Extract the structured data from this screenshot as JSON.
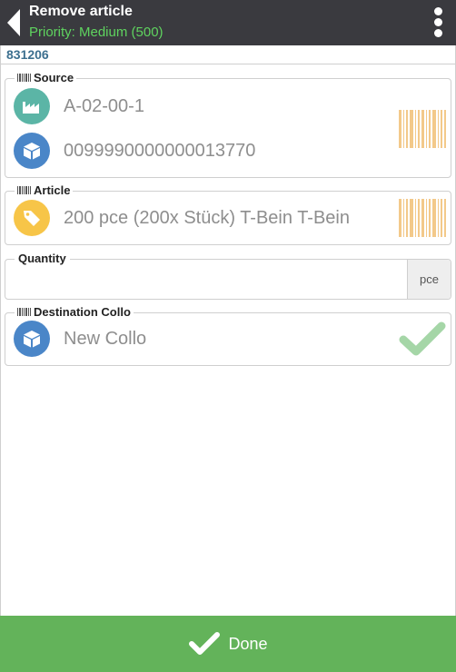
{
  "header": {
    "title": "Remove article",
    "subtitle": "Priority: Medium (500)",
    "back_icon": "chevron-left-icon",
    "menu_icon": "more-vertical-icon"
  },
  "order": {
    "number": "831206"
  },
  "source": {
    "legend": "Source",
    "location": "A-02-00-1",
    "location_icon": "factory-icon",
    "container": "0099990000000013770",
    "container_icon": "box-icon"
  },
  "article": {
    "legend": "Article",
    "text": "200 pce (200x Stück) T-Bein T-Bein",
    "icon": "tag-icon"
  },
  "quantity": {
    "legend": "Quantity",
    "value": "",
    "unit": "pce"
  },
  "destination": {
    "legend": "Destination Collo",
    "text": "New Collo",
    "icon": "box-icon"
  },
  "footer": {
    "done_label": "Done"
  },
  "colors": {
    "header_bg": "#3a3a3f",
    "priority_green": "#5fd35f",
    "factory_teal": "#5bb5a6",
    "box_blue": "#4a86c8",
    "tag_yellow": "#f7c548",
    "barcode_orange": "#f3c98a",
    "check_green": "#a5d6a7",
    "done_green": "#63b35a"
  }
}
